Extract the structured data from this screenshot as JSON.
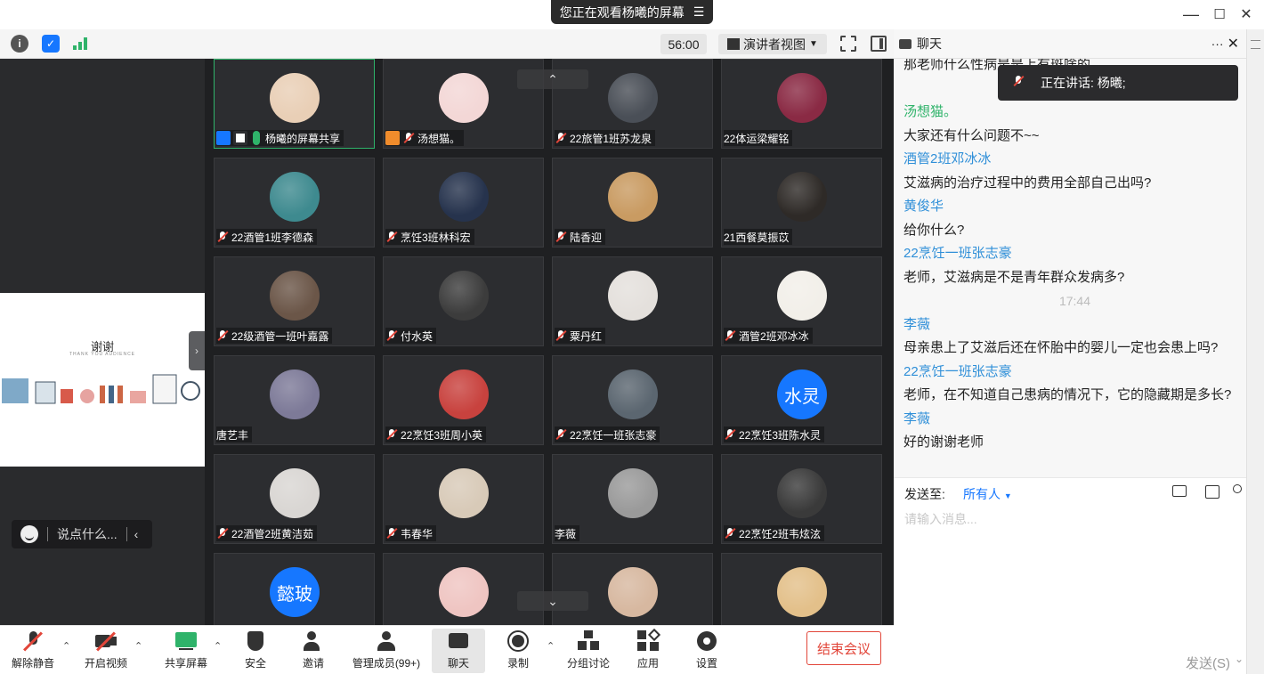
{
  "titlebar": {
    "share_banner": "您正在观看杨曦的屏幕",
    "minimize": "—",
    "maximize": "☐",
    "close": "✕"
  },
  "toolbar": {
    "timer": "56:00",
    "view_mode": "演讲者视图",
    "chat_title": "聊天"
  },
  "preview": {
    "slide_title": "谢谢",
    "slide_subtitle": "THANK YOU AUDIENCE",
    "say_placeholder": "说点什么..."
  },
  "grid": {
    "tiles": [
      {
        "name": "杨曦的屏幕共享",
        "avatar_color": "#e9cfb6",
        "active": true,
        "host": true
      },
      {
        "name": "汤想猫。",
        "avatar_color": "#f3d7d6",
        "cohost": true
      },
      {
        "name": "22旅管1班苏龙泉",
        "avatar_color": "#4a4f57"
      },
      {
        "name": "22体运梁耀铭",
        "avatar_color": "#8a2a44",
        "nomic": true
      },
      {
        "name": "22酒管1班李德森",
        "avatar_color": "#3e8a8f"
      },
      {
        "name": "烹饪3班林科宏",
        "avatar_color": "#26334d"
      },
      {
        "name": "陆香迎",
        "avatar_color": "#c99b62"
      },
      {
        "name": "21西餐莫振苡",
        "avatar_color": "#2e2a27",
        "nomic": true
      },
      {
        "name": "22级酒管一班叶嘉露",
        "avatar_color": "#6b5648"
      },
      {
        "name": "付水英",
        "avatar_color": "#3c3c3c"
      },
      {
        "name": "粟丹红",
        "avatar_color": "#e4e0dc"
      },
      {
        "name": "酒管2班邓冰冰",
        "avatar_color": "#f2efe9"
      },
      {
        "name": "唐艺丰",
        "avatar_color": "#7d7a98",
        "nomic": true
      },
      {
        "name": "22烹饪3班周小英",
        "avatar_color": "#c8423e"
      },
      {
        "name": "22烹饪一班张志豪",
        "avatar_color": "#5b6670"
      },
      {
        "name": "22烹饪3班陈水灵",
        "avatar_text": "水灵"
      },
      {
        "name": "22酒管2班黄洁茹",
        "avatar_color": "#d9d6d3"
      },
      {
        "name": "韦春华",
        "avatar_color": "#d8cab8"
      },
      {
        "name": "李薇",
        "avatar_color": "#9a9a9a",
        "nomic": true
      },
      {
        "name": "22烹饪2班韦炫泫",
        "avatar_color": "#3a3a3a"
      },
      {
        "name": "",
        "avatar_text": "懿玻"
      },
      {
        "name": "",
        "avatar_color": "#efc5c2"
      },
      {
        "name": "",
        "avatar_color": "#d7b8a0"
      },
      {
        "name": "",
        "avatar_color": "#e3c08a"
      }
    ]
  },
  "chat": {
    "top_partial": "那老师什么性病是是上有斑啥的",
    "speaking_label": "正在讲话: 杨曦;",
    "messages": [
      {
        "kind": "gap"
      },
      {
        "kind": "sender",
        "text": "汤想猫。",
        "green": true
      },
      {
        "kind": "text",
        "text": "大家还有什么问题不~~"
      },
      {
        "kind": "sender",
        "text": "酒管2班邓冰冰"
      },
      {
        "kind": "text",
        "text": "艾滋病的治疗过程中的费用全部自己出吗?"
      },
      {
        "kind": "sender",
        "text": "黄俊华"
      },
      {
        "kind": "text",
        "text": "给你什么?"
      },
      {
        "kind": "sender",
        "text": "22烹饪一班张志豪"
      },
      {
        "kind": "text",
        "text": "老师，艾滋病是不是青年群众发病多?"
      },
      {
        "kind": "time",
        "text": "17:44"
      },
      {
        "kind": "sender",
        "text": "李薇"
      },
      {
        "kind": "text",
        "text": "母亲患上了艾滋后还在怀胎中的婴儿一定也会患上吗?"
      },
      {
        "kind": "sender",
        "text": "22烹饪一班张志豪"
      },
      {
        "kind": "text",
        "text": "老师，在不知道自己患病的情况下，它的隐藏期是多长?"
      },
      {
        "kind": "sender",
        "text": "李薇"
      },
      {
        "kind": "text",
        "text": "好的谢谢老师"
      }
    ],
    "send_to_label": "发送至:",
    "send_to_value": "所有人",
    "input_placeholder": "请输入消息...",
    "send_button": "发送(S)"
  },
  "bottombar": {
    "unmute": "解除静音",
    "start_video": "开启视频",
    "share_screen": "共享屏幕",
    "security": "安全",
    "invite": "邀请",
    "manage_members": "管理成员(99+)",
    "chat": "聊天",
    "record": "录制",
    "breakout": "分组讨论",
    "apps": "应用",
    "settings": "设置",
    "end_meeting": "结束会议"
  }
}
